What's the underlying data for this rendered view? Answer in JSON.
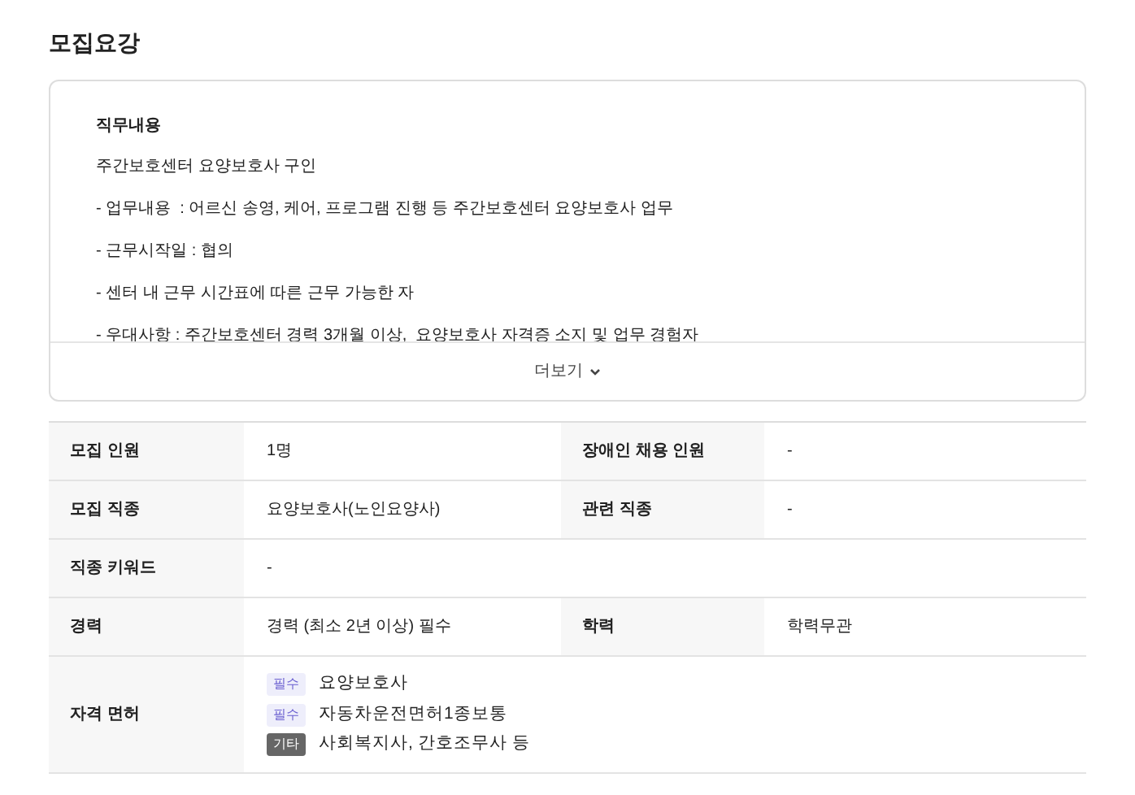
{
  "section_title": "모집요강",
  "description": {
    "heading": "직무내용",
    "lines": [
      "주간보호센터 요양보호사 구인",
      "- 업무내용  : 어르신 송영, 케어, 프로그램 진행 등 주간보호센터 요양보호사 업무",
      "- 근무시작일 : 협의",
      "- 센터 내 근무 시간표에 따른 근무 가능한 자",
      "- 우대사항 : 주간보호센터 경력 3개월 이상,  요양보호사 자격증 소지 및 업무 경험자"
    ],
    "more_button": "더보기"
  },
  "table": {
    "rows": [
      {
        "cells": [
          {
            "label": "모집 인원",
            "value": "1명"
          },
          {
            "label": "장애인 채용 인원",
            "value": "-"
          }
        ]
      },
      {
        "cells": [
          {
            "label": "모집 직종",
            "value": "요양보호사(노인요양사)"
          },
          {
            "label": "관련 직종",
            "value": "-"
          }
        ]
      },
      {
        "cells": [
          {
            "label": "직종 키워드",
            "value": "-"
          }
        ]
      },
      {
        "cells": [
          {
            "label": "경력",
            "value": "경력 (최소 2년 이상) 필수"
          },
          {
            "label": "학력",
            "value": "학력무관"
          }
        ]
      }
    ],
    "licenses": {
      "label": "자격 면허",
      "items": [
        {
          "kind": "required",
          "badge": "필수",
          "text": "요양보호사"
        },
        {
          "kind": "required",
          "badge": "필수",
          "text": "자동차운전면허1종보통"
        },
        {
          "kind": "other",
          "badge": "기타",
          "text": "사회복지사, 간호조무사 등"
        }
      ]
    }
  }
}
